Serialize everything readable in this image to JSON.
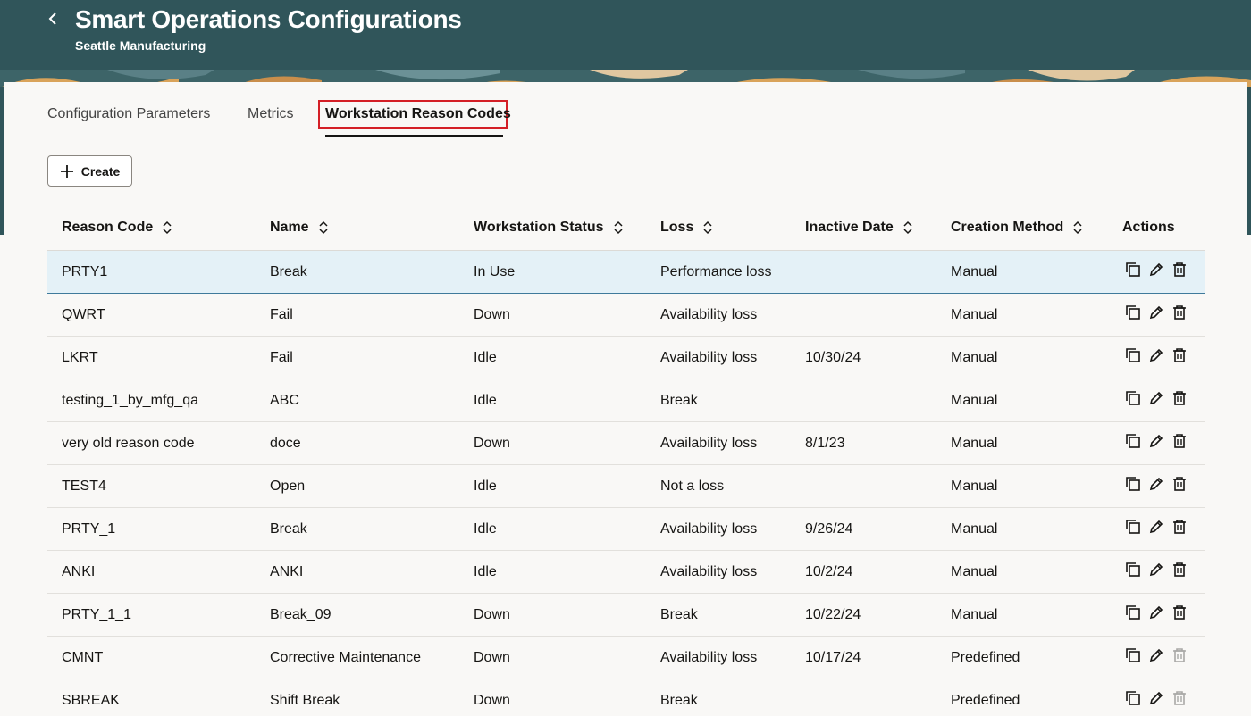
{
  "header": {
    "title": "Smart Operations Configurations",
    "subtitle": "Seattle Manufacturing",
    "back_icon": "chevron-left-icon"
  },
  "tabs": [
    {
      "label": "Configuration Parameters",
      "active": false
    },
    {
      "label": "Metrics",
      "active": false
    },
    {
      "label": "Workstation Reason Codes",
      "active": true
    }
  ],
  "create_button": {
    "label": "Create",
    "icon": "plus-icon"
  },
  "table": {
    "columns": [
      "Reason Code",
      "Name",
      "Workstation Status",
      "Loss",
      "Inactive Date",
      "Creation Method",
      "Actions"
    ],
    "rows": [
      {
        "reason_code": "PRTY1",
        "name": "Break",
        "status": "In Use",
        "loss": "Performance loss",
        "inactive_date": "",
        "method": "Manual",
        "delete_enabled": true
      },
      {
        "reason_code": "QWRT",
        "name": "Fail",
        "status": "Down",
        "loss": "Availability loss",
        "inactive_date": "",
        "method": "Manual",
        "delete_enabled": true
      },
      {
        "reason_code": "LKRT",
        "name": "Fail",
        "status": "Idle",
        "loss": "Availability loss",
        "inactive_date": "10/30/24",
        "method": "Manual",
        "delete_enabled": true
      },
      {
        "reason_code": "testing_1_by_mfg_qa",
        "name": "ABC",
        "status": "Idle",
        "loss": "Break",
        "inactive_date": "",
        "method": "Manual",
        "delete_enabled": true
      },
      {
        "reason_code": "very old reason code",
        "name": "doce",
        "status": "Down",
        "loss": "Availability loss",
        "inactive_date": "8/1/23",
        "method": "Manual",
        "delete_enabled": true
      },
      {
        "reason_code": "TEST4",
        "name": "Open",
        "status": "Idle",
        "loss": "Not a loss",
        "inactive_date": "",
        "method": "Manual",
        "delete_enabled": true
      },
      {
        "reason_code": "PRTY_1",
        "name": "Break",
        "status": "Idle",
        "loss": "Availability loss",
        "inactive_date": "9/26/24",
        "method": "Manual",
        "delete_enabled": true
      },
      {
        "reason_code": "ANKI",
        "name": "ANKI",
        "status": "Idle",
        "loss": "Availability loss",
        "inactive_date": "10/2/24",
        "method": "Manual",
        "delete_enabled": true
      },
      {
        "reason_code": "PRTY_1_1",
        "name": "Break_09",
        "status": "Down",
        "loss": "Break",
        "inactive_date": "10/22/24",
        "method": "Manual",
        "delete_enabled": true
      },
      {
        "reason_code": "CMNT",
        "name": "Corrective Maintenance",
        "status": "Down",
        "loss": "Availability loss",
        "inactive_date": "10/17/24",
        "method": "Predefined",
        "delete_enabled": false
      },
      {
        "reason_code": "SBREAK",
        "name": "Shift Break",
        "status": "Down",
        "loss": "Break",
        "inactive_date": "",
        "method": "Predefined",
        "delete_enabled": false
      }
    ]
  },
  "colors": {
    "header_bg": "#30555a",
    "selected_row_bg": "#e4f1f7",
    "tab_highlight": "#d41f26"
  }
}
